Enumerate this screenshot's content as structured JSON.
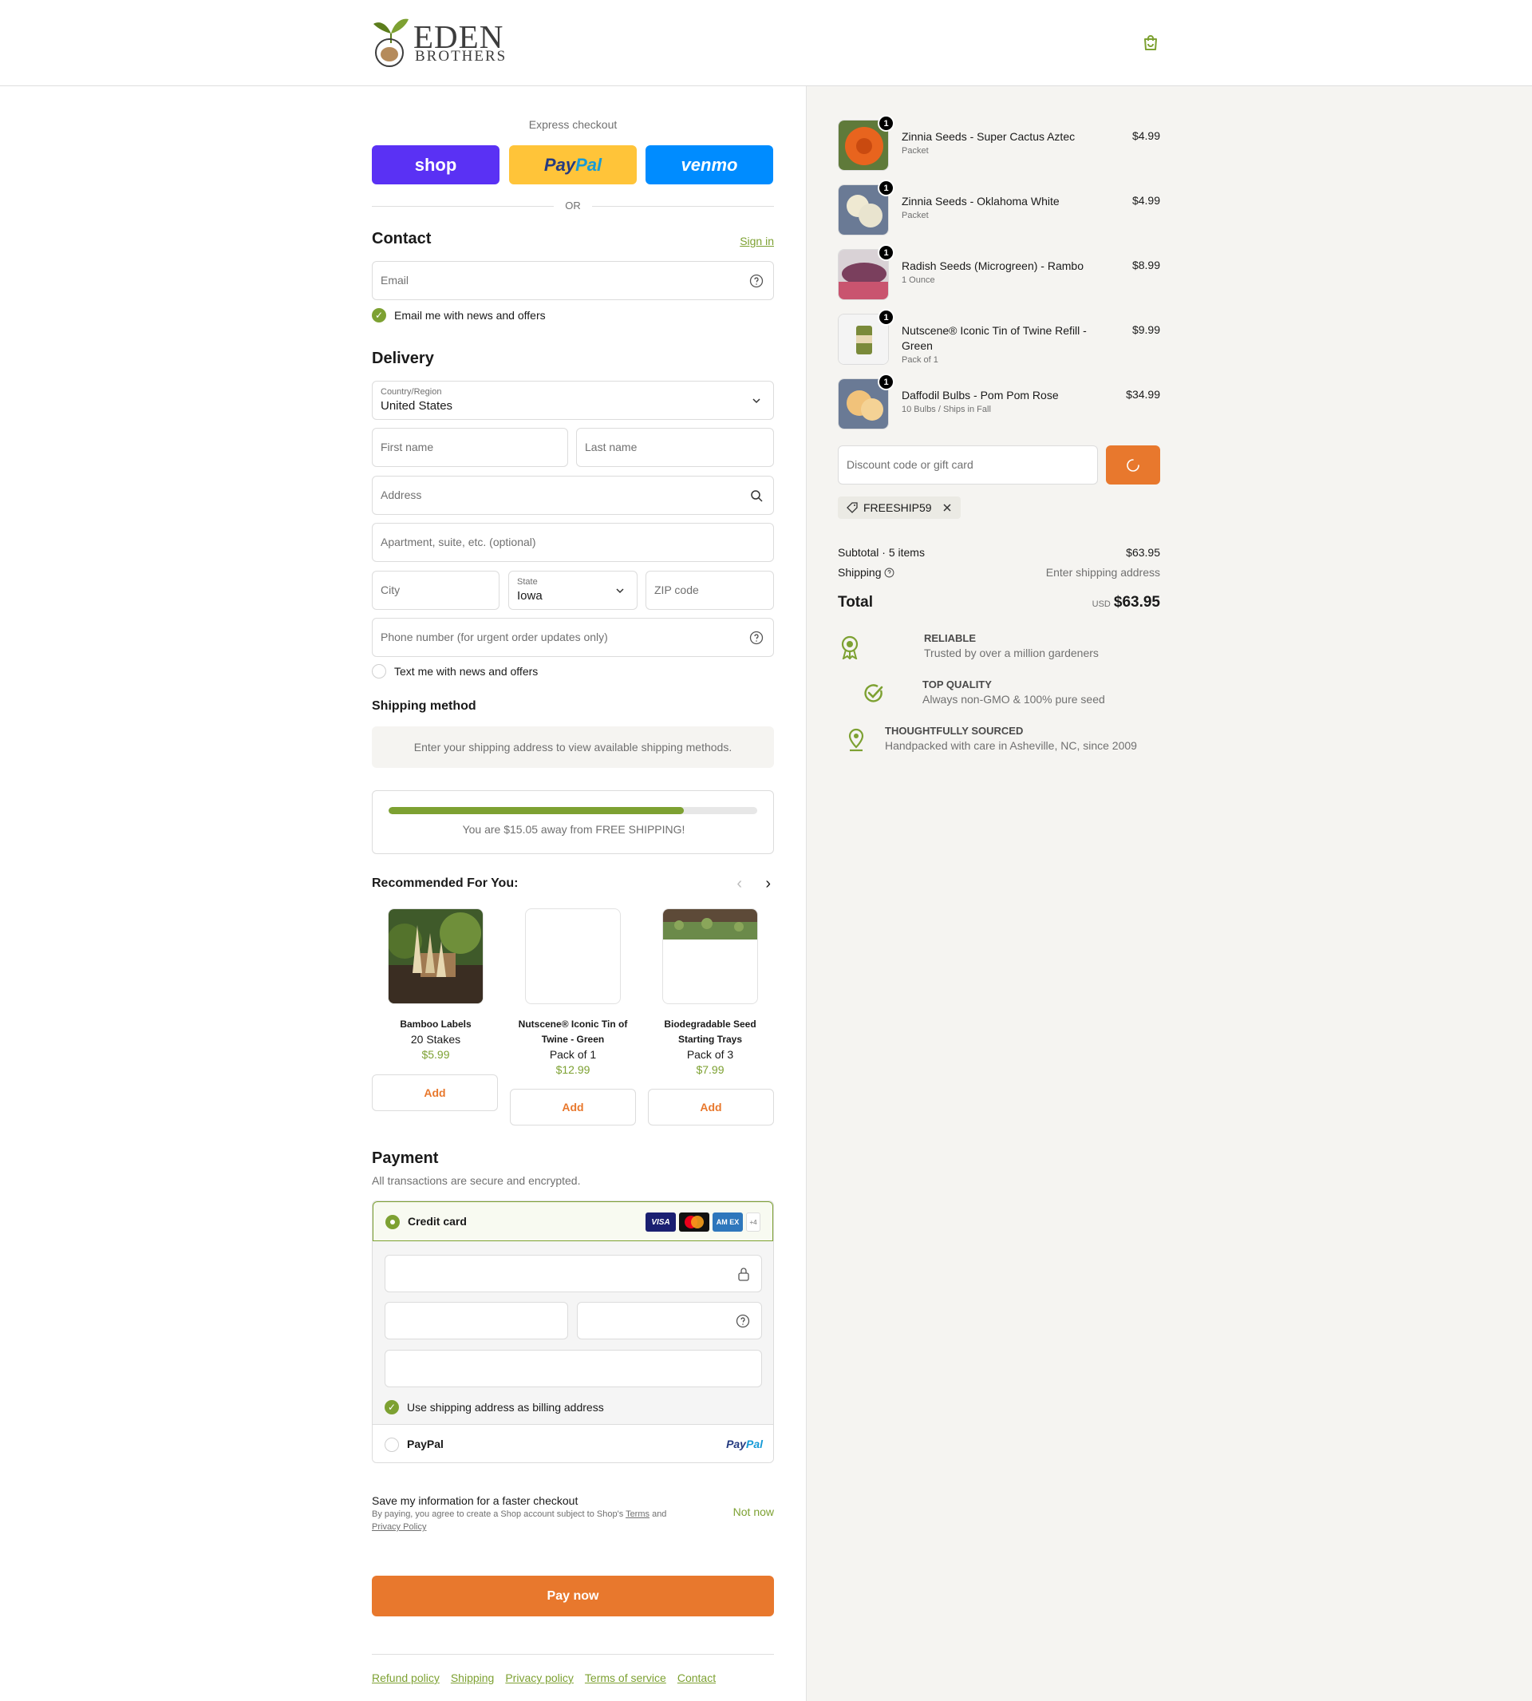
{
  "brand": {
    "logo_line1": "EDEN",
    "logo_line2": "BROTHERS",
    "accent": "#7da132",
    "cta": "#e8782d"
  },
  "express": {
    "title": "Express checkout",
    "shop_label": "shop",
    "paypal_label_a": "Pay",
    "paypal_label_b": "Pal",
    "venmo_label": "venmo",
    "or_label": "OR"
  },
  "contact": {
    "title": "Contact",
    "sign_in": "Sign in",
    "email_placeholder": "Email",
    "news_label": "Email me with news and offers"
  },
  "delivery": {
    "title": "Delivery",
    "country_label": "Country/Region",
    "country_value": "United States",
    "first_name": "First name",
    "last_name": "Last name",
    "address": "Address",
    "apartment": "Apartment, suite, etc. (optional)",
    "city": "City",
    "state_label": "State",
    "state_value": "Iowa",
    "zip": "ZIP code",
    "phone": "Phone number (for urgent order updates only)",
    "text_label": "Text me with news and offers"
  },
  "shipping_method": {
    "title": "Shipping method",
    "info": "Enter your shipping address to view available shipping methods."
  },
  "free_shipping": {
    "progress": 0.8,
    "text": "You are $15.05 away from FREE SHIPPING!"
  },
  "recommended": {
    "title": "Recommended For You:",
    "prev_icon": "‹",
    "next_icon": "›",
    "items": [
      {
        "name": "Bamboo Labels",
        "sub": "20 Stakes",
        "price": "$5.99",
        "add": "Add"
      },
      {
        "name": "Nutscene® Iconic Tin of Twine - Green",
        "sub": "Pack of 1",
        "price": "$12.99",
        "add": "Add"
      },
      {
        "name": "Biodegradable Seed Starting Trays",
        "sub": "Pack of 3",
        "price": "$7.99",
        "add": "Add"
      }
    ]
  },
  "payment": {
    "title": "Payment",
    "subtitle": "All transactions are secure and encrypted.",
    "credit_card": "Credit card",
    "visa": "VISA",
    "amex": "AM EX",
    "more_cards": "+4",
    "billing_label": "Use shipping address as billing address",
    "paypal": "PayPal",
    "paypal_logo_a": "Pay",
    "paypal_logo_b": "Pal"
  },
  "save_info": {
    "title": "Save my information for a faster checkout",
    "fine_a": "By paying, you agree to create a Shop account subject to Shop's ",
    "terms": "Terms",
    "fine_b": " and ",
    "privacy": "Privacy Policy",
    "not_now": "Not now"
  },
  "pay_now": "Pay now",
  "footer": [
    "Refund policy",
    "Shipping",
    "Privacy policy",
    "Terms of service",
    "Contact"
  ],
  "summary": {
    "items": [
      {
        "qty": "1",
        "name": "Zinnia Seeds - Super Cactus Aztec",
        "variant": "Packet",
        "price": "$4.99",
        "thumb_color": "#e8641e"
      },
      {
        "qty": "1",
        "name": "Zinnia Seeds - Oklahoma White",
        "variant": "Packet",
        "price": "$4.99",
        "thumb_color": "#e9e4cf"
      },
      {
        "qty": "1",
        "name": "Radish Seeds (Microgreen) - Rambo",
        "variant": "1 Ounce",
        "price": "$8.99",
        "thumb_color": "#7a3f5d"
      },
      {
        "qty": "1",
        "name": "Nutscene® Iconic Tin of Twine Refill - Green",
        "variant": "Pack of 1",
        "price": "$9.99",
        "thumb_color": "#7a8a3a"
      },
      {
        "qty": "1",
        "name": "Daffodil Bulbs - Pom Pom Rose",
        "variant": "10 Bulbs / Ships in Fall",
        "price": "$34.99",
        "thumb_color": "#f1c27a"
      }
    ],
    "discount_placeholder": "Discount code or gift card",
    "code": "FREESHIP59",
    "subtotal_label": "Subtotal · 5 items",
    "subtotal_value": "$63.95",
    "shipping_label": "Shipping",
    "shipping_value": "Enter shipping address",
    "total_label": "Total",
    "currency": "USD",
    "total_value": "$63.95",
    "badges": [
      {
        "icon": "ribbon-award-icon",
        "title": "RELIABLE",
        "desc": "Trusted by over a million gardeners"
      },
      {
        "icon": "check-circle-icon",
        "title": "TOP QUALITY",
        "desc": "Always non-GMO & 100% pure seed"
      },
      {
        "icon": "location-pin-icon",
        "title": "THOUGHTFULLY SOURCED",
        "desc": "Handpacked with care in Asheville, NC, since 2009"
      }
    ]
  }
}
